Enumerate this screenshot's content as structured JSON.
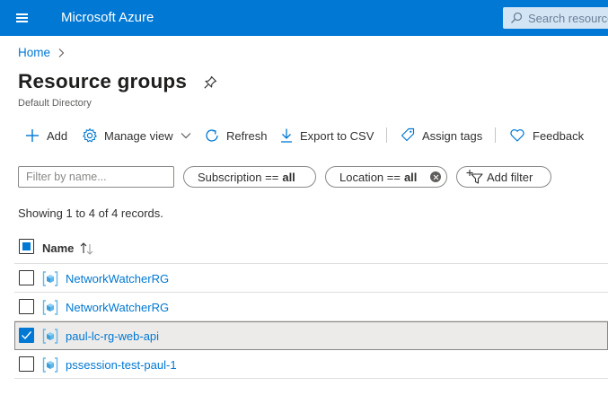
{
  "app": {
    "brand": "Microsoft Azure"
  },
  "search": {
    "placeholder": "Search resources"
  },
  "breadcrumb": {
    "home": "Home"
  },
  "page": {
    "title": "Resource groups",
    "subtitle": "Default Directory"
  },
  "toolbar": {
    "add": "Add",
    "manage_view": "Manage view",
    "refresh": "Refresh",
    "export": "Export to CSV",
    "assign_tags": "Assign tags",
    "feedback": "Feedback"
  },
  "filters": {
    "name_placeholder": "Filter by name...",
    "subscription_label": "Subscription ==",
    "subscription_value": "all",
    "location_label": "Location ==",
    "location_value": "all",
    "add_filter": "Add filter"
  },
  "records_text": "Showing 1 to 4 of 4 records.",
  "table": {
    "column_name": "Name",
    "header_checkbox": "partial",
    "rows": [
      {
        "name": "NetworkWatcherRG",
        "checked": false
      },
      {
        "name": "NetworkWatcherRG",
        "checked": false
      },
      {
        "name": "paul-lc-rg-web-api",
        "checked": true
      },
      {
        "name": "pssession-test-paul-1",
        "checked": false
      }
    ]
  },
  "colors": {
    "accent": "#0078d4",
    "selected_row": "#edebe9"
  },
  "icons": [
    "hamburger-icon",
    "search-icon",
    "chevron-right-icon",
    "pin-icon",
    "plus-icon",
    "gear-icon",
    "chevron-down-icon",
    "refresh-icon",
    "download-icon",
    "tag-icon",
    "heart-icon",
    "close-icon",
    "filter-icon",
    "sort-icon",
    "resource-group-icon",
    "checkmark-icon"
  ]
}
